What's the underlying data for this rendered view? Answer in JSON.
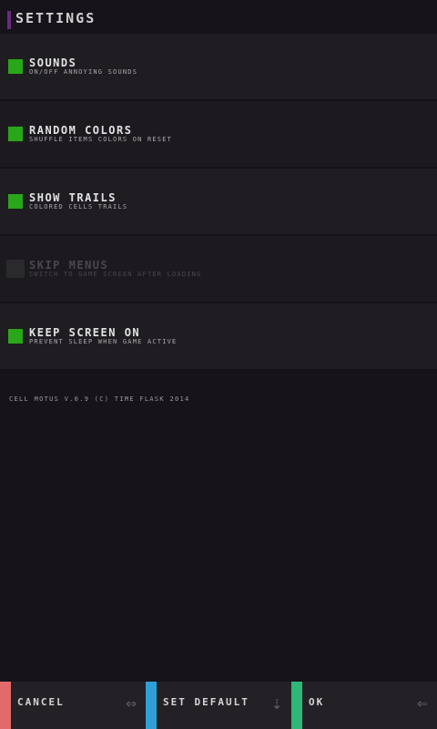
{
  "header": {
    "title": "SETTINGS",
    "accent_color": "#6b2a7f"
  },
  "options": [
    {
      "label": "SOUNDS",
      "description": "ON/OFF ANNOYING SOUNDS",
      "checked": true
    },
    {
      "label": "RANDOM COLORS",
      "description": "SHUFFLE ITEMS COLORS ON RESET",
      "checked": true
    },
    {
      "label": "SHOW TRAILS",
      "description": "COLORED CELLS TRAILS",
      "checked": true
    },
    {
      "label": "SKIP MENUS",
      "description": "SWITCH TO GAME SCREEN AFTER LOADING",
      "checked": false
    },
    {
      "label": "KEEP SCREEN ON",
      "description": "PREVENT SLEEP WHEN GAME ACTIVE",
      "checked": true
    }
  ],
  "version_text": "CELL MOTUS V.0.9 (C) TIME FLASK 2014",
  "footer": {
    "cancel": {
      "label": "CANCEL",
      "color": "#e26a6a",
      "icon": "swap-arrow-icon"
    },
    "set_default": {
      "label": "SET DEFAULT",
      "color": "#2f9fd8",
      "icon": "down-arrow-icon"
    },
    "ok": {
      "label": "OK",
      "color": "#2db878",
      "icon": "back-arrow-icon"
    }
  },
  "colors": {
    "checked": "#2aa61a",
    "background": "#17131a",
    "row": "#1f1d22"
  }
}
